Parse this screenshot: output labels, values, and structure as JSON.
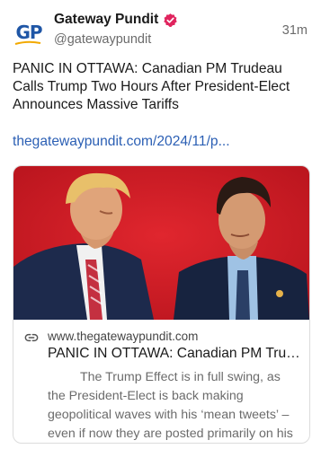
{
  "post": {
    "avatar_text": "GP",
    "display_name": "Gateway Pundit",
    "handle": "@gatewaypundit",
    "time": "31m",
    "text": "PANIC IN OTTAWA: Canadian PM Trudeau Calls Trump Two Hours After President-Elect Announces Massive Tariffs",
    "link": "thegatewaypundit.com/2024/11/p..."
  },
  "card": {
    "domain": "www.thegatewaypundit.com",
    "title": "PANIC IN OTTAWA: Canadian PM Trudeau Calls Trump Two Hours After President-Elect Announces Massive Tariffs",
    "description": "The Trump Effect is in full swing, as the President-Elect is back making geopolitical waves with his ‘mean tweets’ – even if now they are posted primarily on his social platf..."
  },
  "colors": {
    "brand_blue": "#1f56a6",
    "link_blue": "#2b5fb4",
    "verified_pink": "#e0245e",
    "image_background_red": "#d4202a"
  },
  "icons": [
    "verified-badge-icon",
    "link-icon"
  ]
}
